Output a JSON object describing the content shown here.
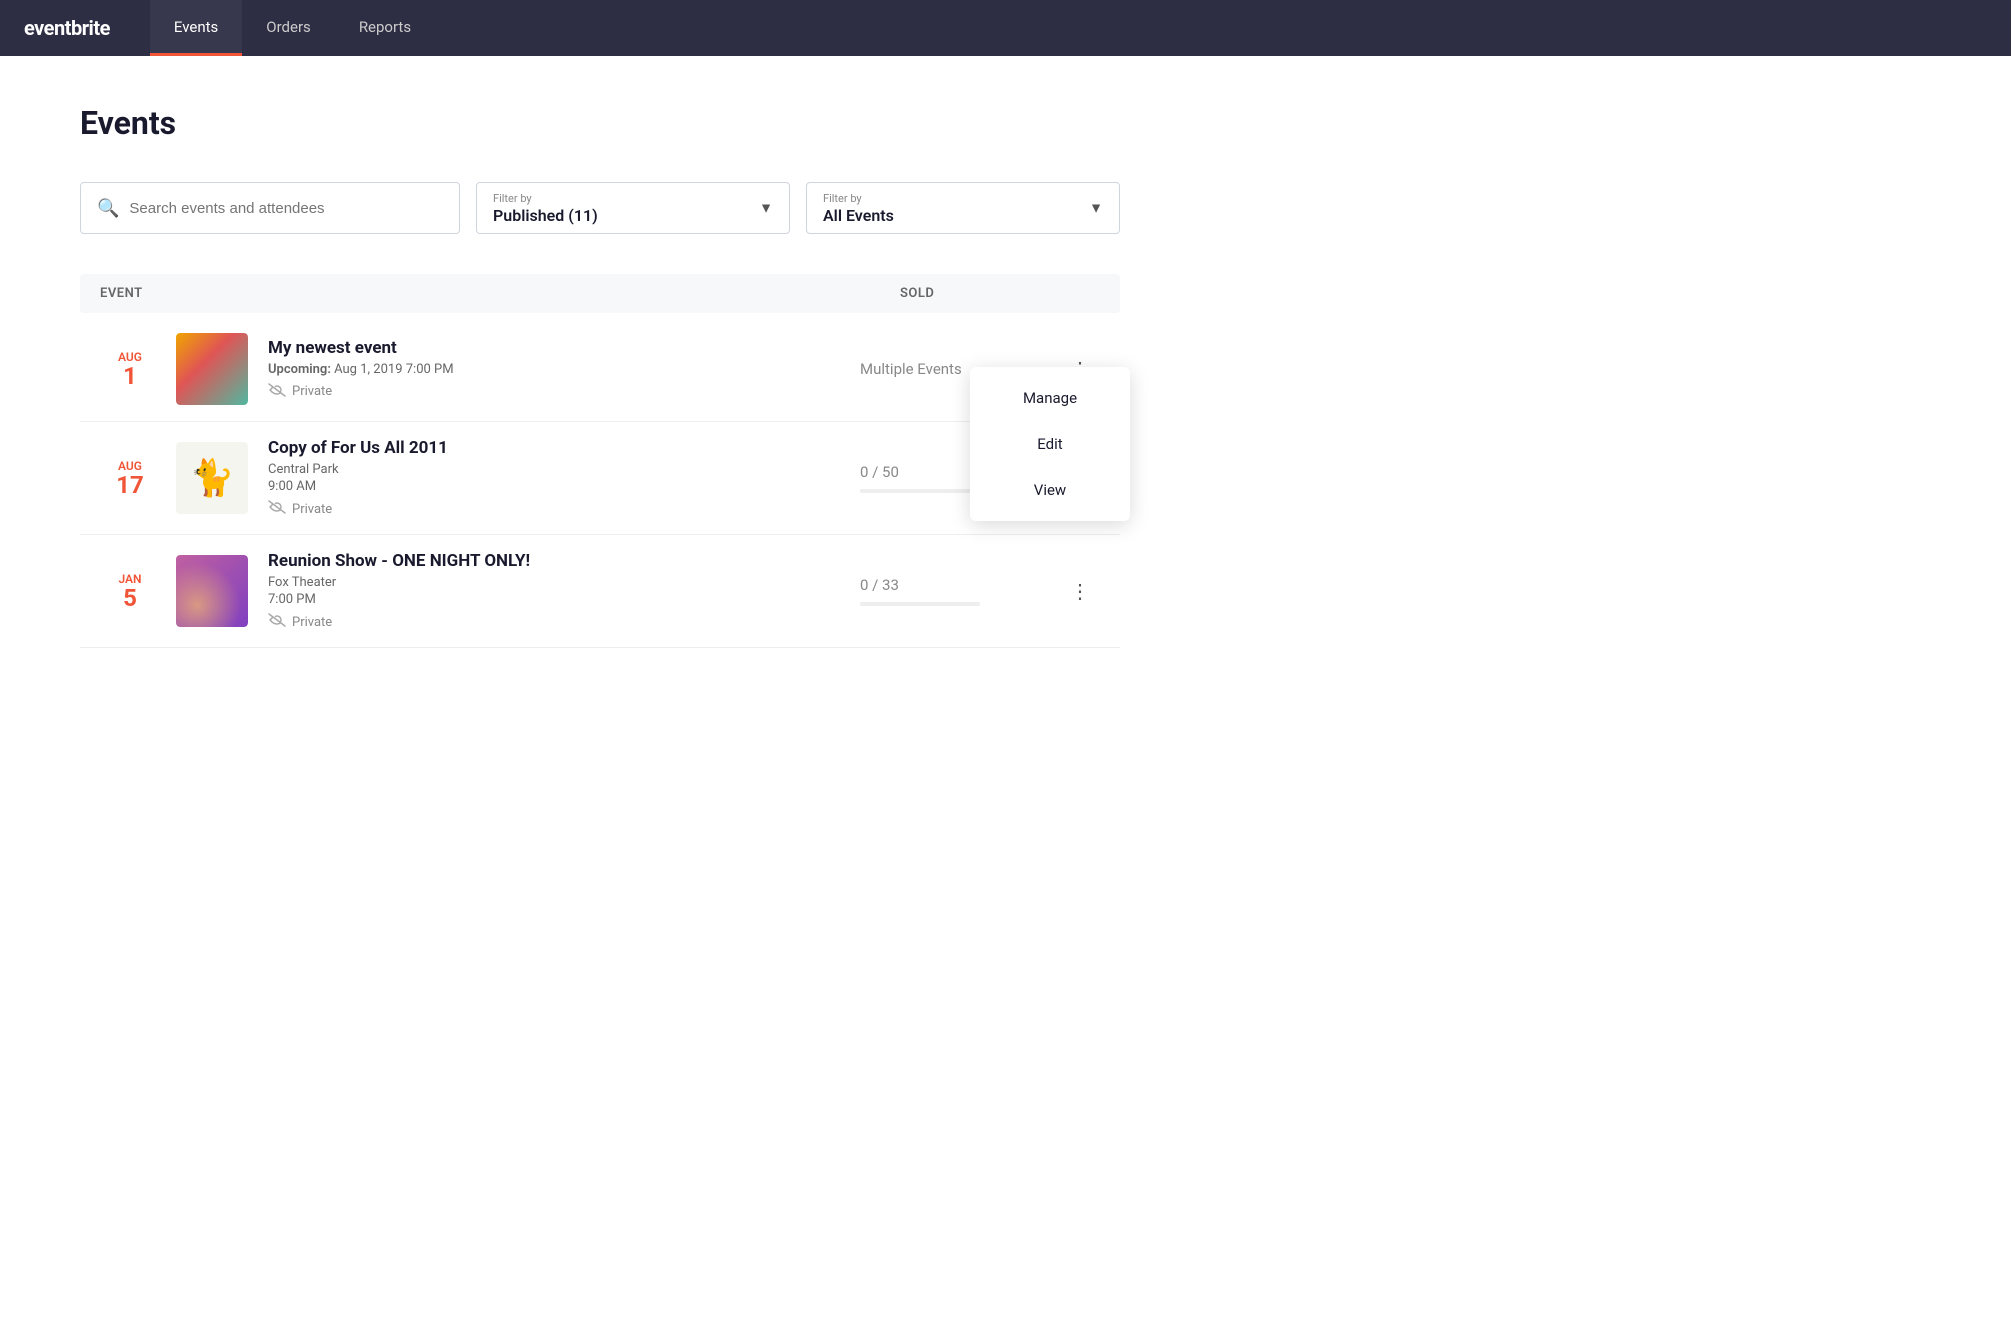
{
  "nav": {
    "logo": "eventbrite",
    "links": [
      {
        "label": "Events",
        "active": true
      },
      {
        "label": "Orders",
        "active": false
      },
      {
        "label": "Reports",
        "active": false
      }
    ]
  },
  "page": {
    "title": "Events"
  },
  "filters": {
    "search_placeholder": "Search events and attendees",
    "filter1_label": "Filter by",
    "filter1_value": "Published (11)",
    "filter2_label": "Filter by",
    "filter2_value": "All Events"
  },
  "table": {
    "col_event": "Event",
    "col_sold": "Sold"
  },
  "events": [
    {
      "month": "Aug",
      "day": "1",
      "name": "My newest event",
      "status": "Upcoming",
      "date": "Aug 1, 2019 7:00 PM",
      "venue": "",
      "is_private": true,
      "sold": "Multiple Events",
      "thumb_type": "gradient1",
      "show_menu": true
    },
    {
      "month": "Aug",
      "day": "17",
      "name": "Copy of For Us All 2011",
      "status": "",
      "date": "9:00 AM",
      "venue": "Central Park",
      "is_private": true,
      "sold": "0 / 50",
      "thumb_type": "emoji",
      "show_menu": false
    },
    {
      "month": "Jan",
      "day": "5",
      "name": "Reunion Show - ONE NIGHT ONLY!",
      "status": "",
      "date": "7:00 PM",
      "venue": "Fox Theater",
      "is_private": true,
      "sold": "0 / 33",
      "thumb_type": "gradient2",
      "show_menu": false
    }
  ],
  "dropdown": {
    "items": [
      "Manage",
      "Edit",
      "View"
    ]
  },
  "icons": {
    "search": "🔍",
    "chevron_down": "▾",
    "private": "👁",
    "three_dots": "⋮"
  }
}
